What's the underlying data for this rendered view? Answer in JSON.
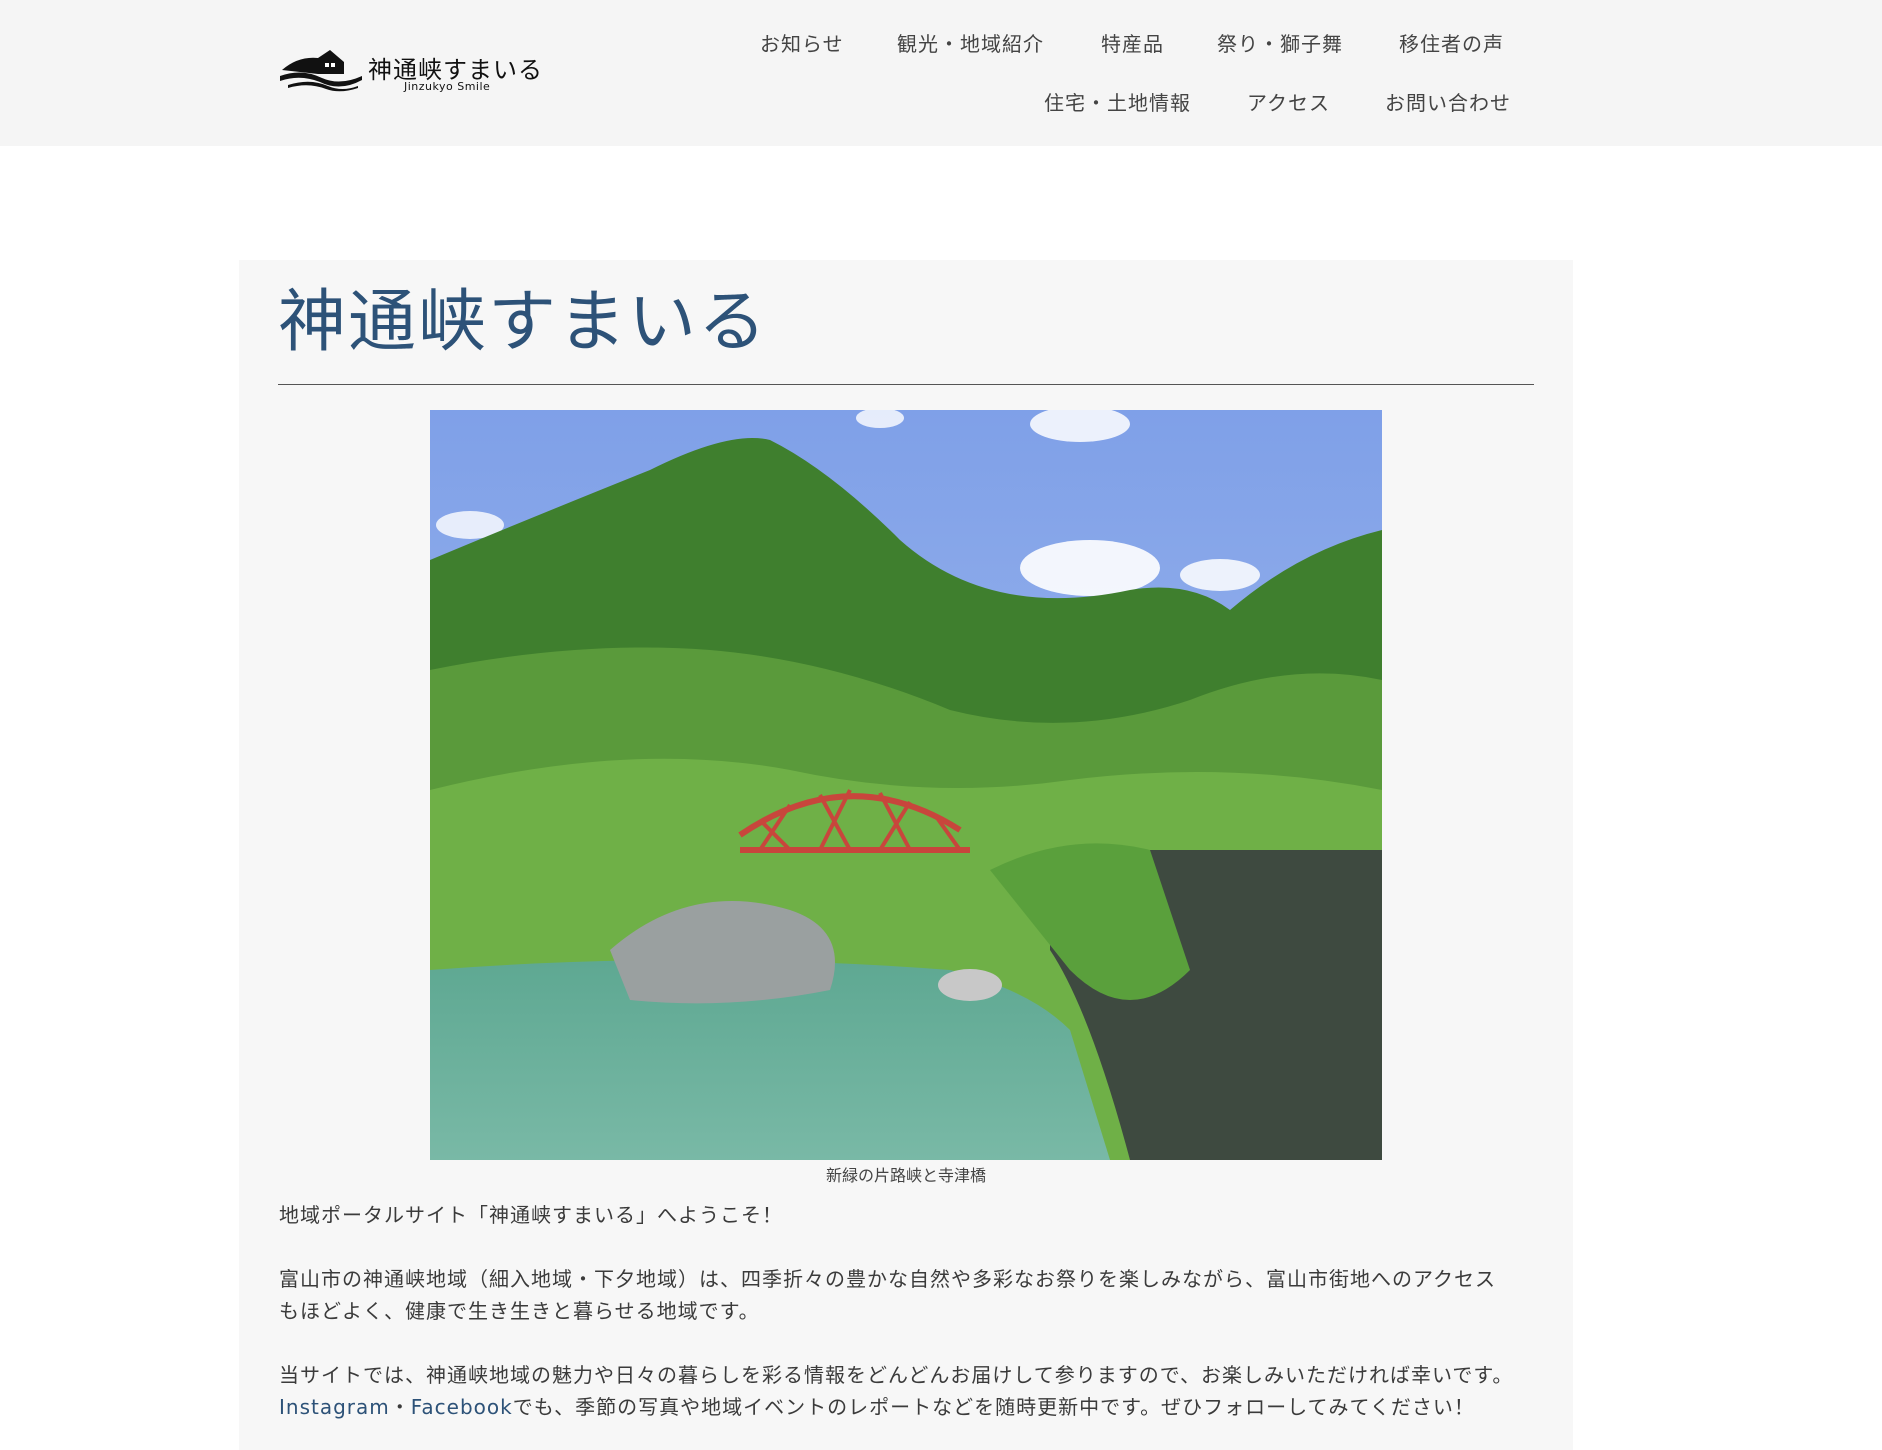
{
  "header": {
    "logo_title": "神通峡すまいる",
    "logo_subtitle": "Jinzukyo Smile",
    "nav_row1": [
      "お知らせ",
      "観光・地域紹介",
      "特産品",
      "祭り・獅子舞",
      "移住者の声"
    ],
    "nav_row2": [
      "住宅・土地情報",
      "アクセス",
      "お問い合わせ"
    ]
  },
  "main": {
    "title": "神通峡すまいる",
    "hero_caption": "新緑の片路峡と寺津橋",
    "welcome": "地域ポータルサイト「神通峡すまいる」へようこそ！",
    "intro_line1": "富山市の神通峡地域（細入地域・下夕地域）は、四季折々の豊かな自然や多彩なお祭りを楽しみながら、富山市街地へのアクセス",
    "intro_line2": "もほどよく、健康で生き生きと暮らせる地域です。",
    "closing_line1": "当サイトでは、神通峡地域の魅力や日々の暮らしを彩る情報をどんどんお届けして参りますので、お楽しみいただければ幸いです。",
    "instagram_link": "Instagram",
    "separator": "・",
    "facebook_link": "Facebook",
    "closing_line2_rest": "でも、季節の写真や地域イベントのレポートなどを随時更新中です。ぜひフォローしてみてください！"
  },
  "colors": {
    "title": "#2d5278",
    "link": "#2d5278",
    "header_bg": "#f5f5f5",
    "content_bg": "#f7f7f7"
  }
}
